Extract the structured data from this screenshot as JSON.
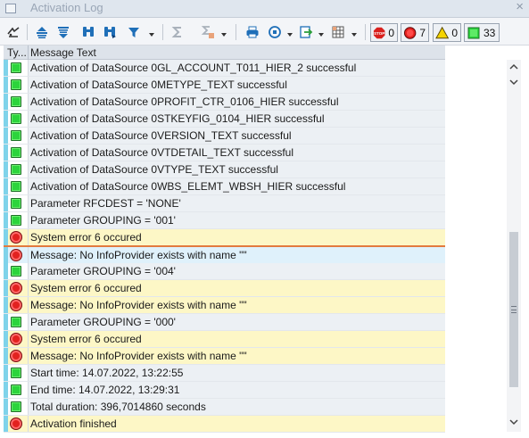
{
  "window": {
    "title": "Activation Log",
    "close_glyph": "×"
  },
  "toolbar": {
    "buttons": [
      "details-icon",
      "sort-ascending-icon",
      "sort-descending-icon",
      "find-icon",
      "find-next-icon",
      "filter-icon",
      "sum-icon",
      "subtotal-icon",
      "print-icon",
      "views-icon",
      "export-icon",
      "layout-icon"
    ],
    "counters": {
      "stop": "0",
      "error": "7",
      "warning": "0",
      "success": "33"
    },
    "colors": {
      "stop": "#e2211f",
      "error": "#e2211f",
      "warning": "#f5d400",
      "success": "#2cd43c"
    }
  },
  "table": {
    "columns": [
      "Ty...",
      "Message Text"
    ],
    "rows": [
      {
        "type": "success",
        "text": "Activation of DataSource 0GL_ACCOUNT_T011_HIER_2 successful"
      },
      {
        "type": "success",
        "text": "Activation of DataSource 0METYPE_TEXT successful"
      },
      {
        "type": "success",
        "text": "Activation of DataSource 0PROFIT_CTR_0106_HIER successful"
      },
      {
        "type": "success",
        "text": "Activation of DataSource 0STKEYFIG_0104_HIER successful"
      },
      {
        "type": "success",
        "text": "Activation of DataSource 0VERSION_TEXT successful"
      },
      {
        "type": "success",
        "text": "Activation of DataSource 0VTDETAIL_TEXT successful"
      },
      {
        "type": "success",
        "text": "Activation of DataSource 0VTYPE_TEXT successful"
      },
      {
        "type": "success",
        "text": "Activation of DataSource 0WBS_ELEMT_WBSH_HIER successful"
      },
      {
        "type": "success",
        "text": "Parameter RFCDEST = 'NONE'"
      },
      {
        "type": "success",
        "text": "Parameter GROUPING = '001'"
      },
      {
        "type": "error",
        "text": "System error 6 occured"
      },
      {
        "type": "error",
        "text": "Message: No InfoProvider exists with name \"\"",
        "selected": true
      },
      {
        "type": "success",
        "text": "Parameter GROUPING = '004'"
      },
      {
        "type": "error",
        "text": "System error 6 occured"
      },
      {
        "type": "error",
        "text": "Message: No InfoProvider exists with name \"\""
      },
      {
        "type": "success",
        "text": "Parameter GROUPING = '000'"
      },
      {
        "type": "error",
        "text": "System error 6 occured"
      },
      {
        "type": "error",
        "text": "Message: No InfoProvider exists with name \"\""
      },
      {
        "type": "success",
        "text": "Start time: 14.07.2022, 13:22:55"
      },
      {
        "type": "success",
        "text": "End time: 14.07.2022, 13:29:31"
      },
      {
        "type": "success",
        "text": "Total duration: 396,7014860 seconds"
      },
      {
        "type": "error",
        "text": "Activation finished"
      }
    ]
  }
}
